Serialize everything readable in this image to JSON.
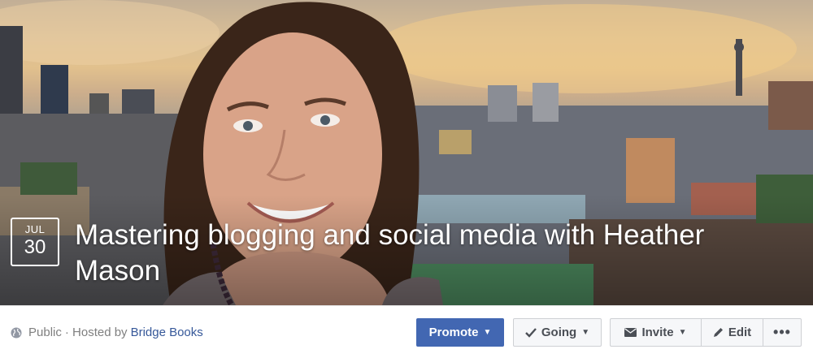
{
  "event": {
    "date_month": "JUL",
    "date_day": "30",
    "title": "Mastering blogging and social media with Heather Mason"
  },
  "meta": {
    "privacy": "Public",
    "separator": " · Hosted by",
    "host": "Bridge Books",
    "icon": "globe-icon"
  },
  "actions": {
    "promote": "Promote",
    "going": "Going",
    "invite": "Invite",
    "edit": "Edit",
    "more": "•••"
  },
  "colors": {
    "primary": "#4267b2",
    "link": "#365899"
  }
}
